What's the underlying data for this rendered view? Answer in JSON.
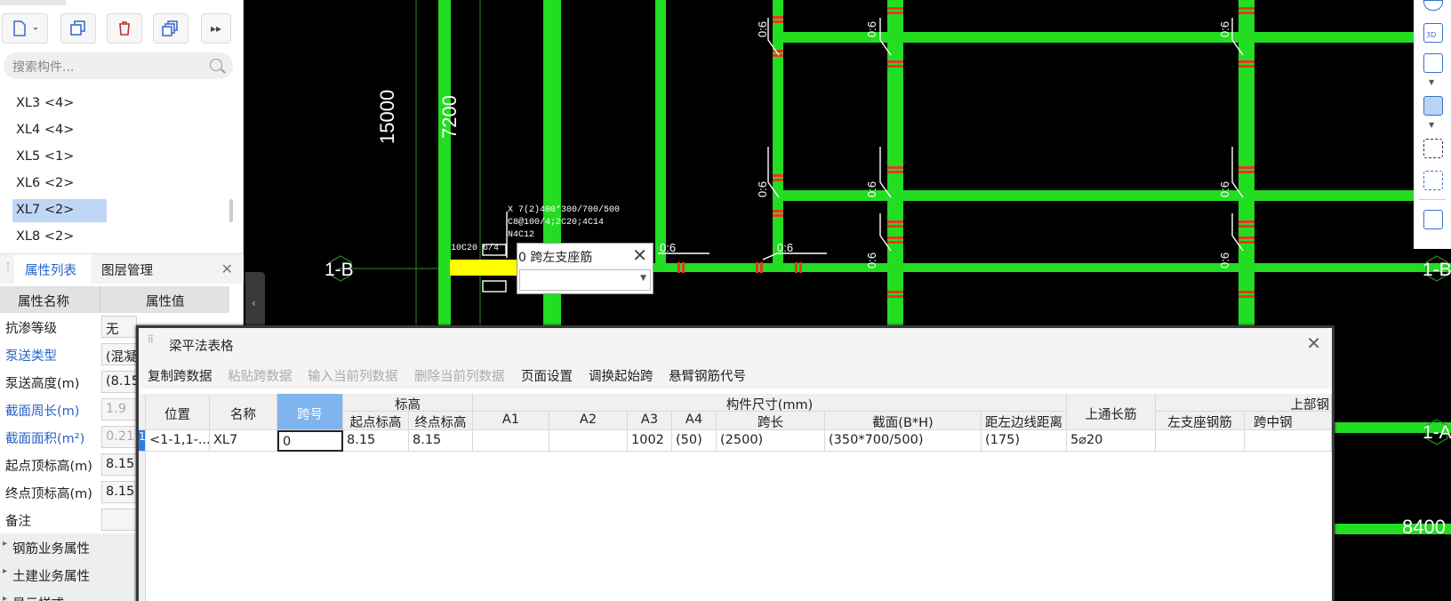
{
  "left_panel": {
    "search_placeholder": "搜索构件...",
    "components": [
      {
        "label": "XL3 <4>"
      },
      {
        "label": "XL4 <4>"
      },
      {
        "label": "XL5 <1>"
      },
      {
        "label": "XL6 <2>"
      },
      {
        "label": "XL7 <2>",
        "selected": true
      },
      {
        "label": "XL8 <2>"
      }
    ],
    "tabs": [
      "属性列表",
      "图层管理"
    ],
    "prop_header": {
      "name": "属性名称",
      "value": "属性值"
    },
    "props": [
      {
        "name": "抗渗等级",
        "value": "无",
        "link": false
      },
      {
        "name": "泵送类型",
        "value": "(混凝",
        "link": true
      },
      {
        "name": "泵送高度(m)",
        "value": "(8.15",
        "link": false
      },
      {
        "name": "截面周长(m)",
        "value": "1.9",
        "link": true
      },
      {
        "name": "截面面积(m²)",
        "value": "0.21",
        "link": true
      },
      {
        "name": "起点顶标高(m)",
        "value": "8.15",
        "link": false
      },
      {
        "name": "终点顶标高(m)",
        "value": "8.15",
        "link": false
      },
      {
        "name": "备注",
        "value": "",
        "link": false
      }
    ],
    "groups": [
      "钢筋业务属性",
      "土建业务属性",
      "显示样式"
    ]
  },
  "canvas_labels": {
    "dim_15000": "15000",
    "dim_7200": "7200",
    "dim_8400": "8400",
    "axis_1B_left": "1-B",
    "axis_1B_right": "1-B",
    "axis_1A_right": "1-A",
    "beam_annot_1": "X 7(2)400*300/700/500",
    "beam_annot_2": "C8@100/4;2C20;4C14",
    "beam_annot_3": "N4C12",
    "beam_annot_4": "10C20 6/4",
    "span_label": "0:6"
  },
  "pin_popup": {
    "title": "0 跨左支座筋",
    "close": "✕"
  },
  "dialog": {
    "title": "梁平法表格",
    "close": "✕",
    "menu": [
      {
        "label": "复制跨数据",
        "enabled": true
      },
      {
        "label": "粘贴跨数据",
        "enabled": false
      },
      {
        "label": "输入当前列数据",
        "enabled": false
      },
      {
        "label": "删除当前列数据",
        "enabled": false
      },
      {
        "label": "页面设置",
        "enabled": true
      },
      {
        "label": "调换起始跨",
        "enabled": true
      },
      {
        "label": "悬臂钢筋代号",
        "enabled": true
      }
    ],
    "headers": {
      "position": "位置",
      "name": "名称",
      "span_no": "跨号",
      "elevation": "标高",
      "start_elev": "起点标高",
      "end_elev": "终点标高",
      "size": "构件尺寸(mm)",
      "a1": "A1",
      "a2": "A2",
      "a3": "A3",
      "a4": "A4",
      "span_len": "跨长",
      "section": "截面(B*H)",
      "offset": "距左边线距离",
      "top_through": "上通长筋",
      "top_group": "上部钢",
      "left_support": "左支座钢筋",
      "mid_span": "跨中钢"
    },
    "row": {
      "no": "1",
      "position": "<1-1,1-...",
      "name": "XL7",
      "span_no": "0",
      "start_elev": "8.15",
      "end_elev": "8.15",
      "a1": "",
      "a2": "",
      "a3": "1002",
      "a4": "(50)",
      "span_len": "(2500)",
      "section": "(350*700/500)",
      "offset": "(175)",
      "top_through": "5⌀20",
      "left_support": "",
      "mid_span": ""
    }
  },
  "colors": {
    "beam_green": "#22dd22",
    "highlight_yellow": "#ffff00",
    "accent_blue": "#2062c8"
  }
}
